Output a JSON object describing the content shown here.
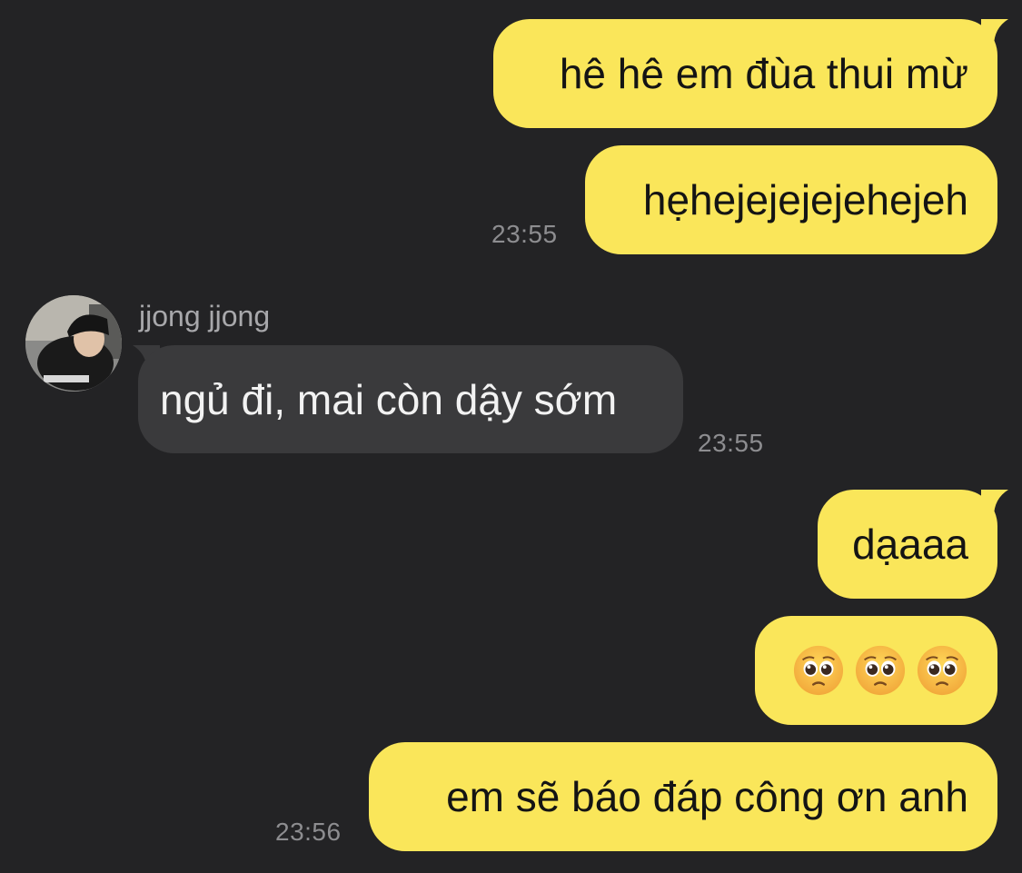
{
  "contact": {
    "name": "jjong jjong"
  },
  "messages": [
    {
      "from": "me",
      "text": "hê hê em đùa thui mừ"
    },
    {
      "from": "me",
      "text": "hẹhejejejejehejeh",
      "time": "23:55"
    },
    {
      "from": "contact",
      "text": "ngủ đi, mai còn dậy sớm",
      "time": "23:55"
    },
    {
      "from": "me",
      "text": "dạaaa"
    },
    {
      "from": "me",
      "emojis": [
        "pleading-face",
        "pleading-face",
        "pleading-face"
      ]
    },
    {
      "from": "me",
      "text": "em sẽ báo đáp công ơn anh",
      "time": "23:56"
    }
  ],
  "colors": {
    "background": "#232325",
    "outgoing_bubble": "#fae65a",
    "incoming_bubble": "#3a3a3c",
    "timestamp": "#8d8d90"
  }
}
